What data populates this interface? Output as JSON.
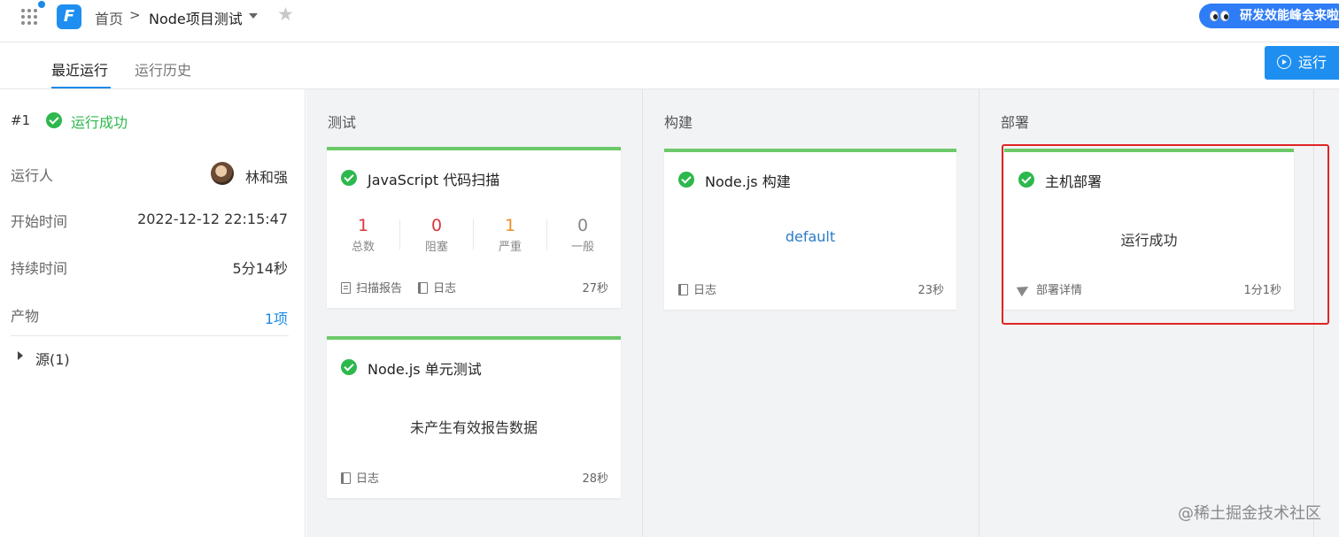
{
  "header": {
    "home": "首页",
    "separator": ">",
    "project": "Node项目测试",
    "promo": "研发效能峰会来啦"
  },
  "tabs": {
    "recent": "最近运行",
    "history": "运行历史",
    "run_button": "运行"
  },
  "run": {
    "number": "#1",
    "status": "运行成功",
    "runner_label": "运行人",
    "runner": "林和强",
    "start_label": "开始时间",
    "start": "2022-12-12 22:15:47",
    "duration_label": "持续时间",
    "duration": "5分14秒",
    "artifacts_label": "产物",
    "artifacts": "1项",
    "source": "源(1)"
  },
  "stages": [
    {
      "title": "测试",
      "cards": [
        {
          "title": "JavaScript 代码扫描",
          "metrics": [
            {
              "value": "1",
              "label": "总数",
              "color": "#d9363e"
            },
            {
              "value": "0",
              "label": "阻塞",
              "color": "#d9363e"
            },
            {
              "value": "1",
              "label": "严重",
              "color": "#f08c2a"
            },
            {
              "value": "0",
              "label": "一般",
              "color": "#888888"
            }
          ],
          "footer_report": "扫描报告",
          "footer_log": "日志",
          "time": "27秒"
        },
        {
          "title": "Node.js 单元测试",
          "message": "未产生有效报告数据",
          "footer_log": "日志",
          "time": "28秒"
        }
      ]
    },
    {
      "title": "构建",
      "cards": [
        {
          "title": "Node.js 构建",
          "message": "default",
          "footer_log": "日志",
          "time": "23秒"
        }
      ]
    },
    {
      "title": "部署",
      "cards": [
        {
          "title": "主机部署",
          "message": "运行成功",
          "footer_detail": "部署详情",
          "time": "1分1秒"
        }
      ]
    }
  ],
  "watermark": "@稀土掘金技术社区",
  "colors": {
    "accent": "#1e8ff0",
    "success": "#2db84d",
    "card_top": "#6cc96a",
    "highlight": "#e02424"
  }
}
